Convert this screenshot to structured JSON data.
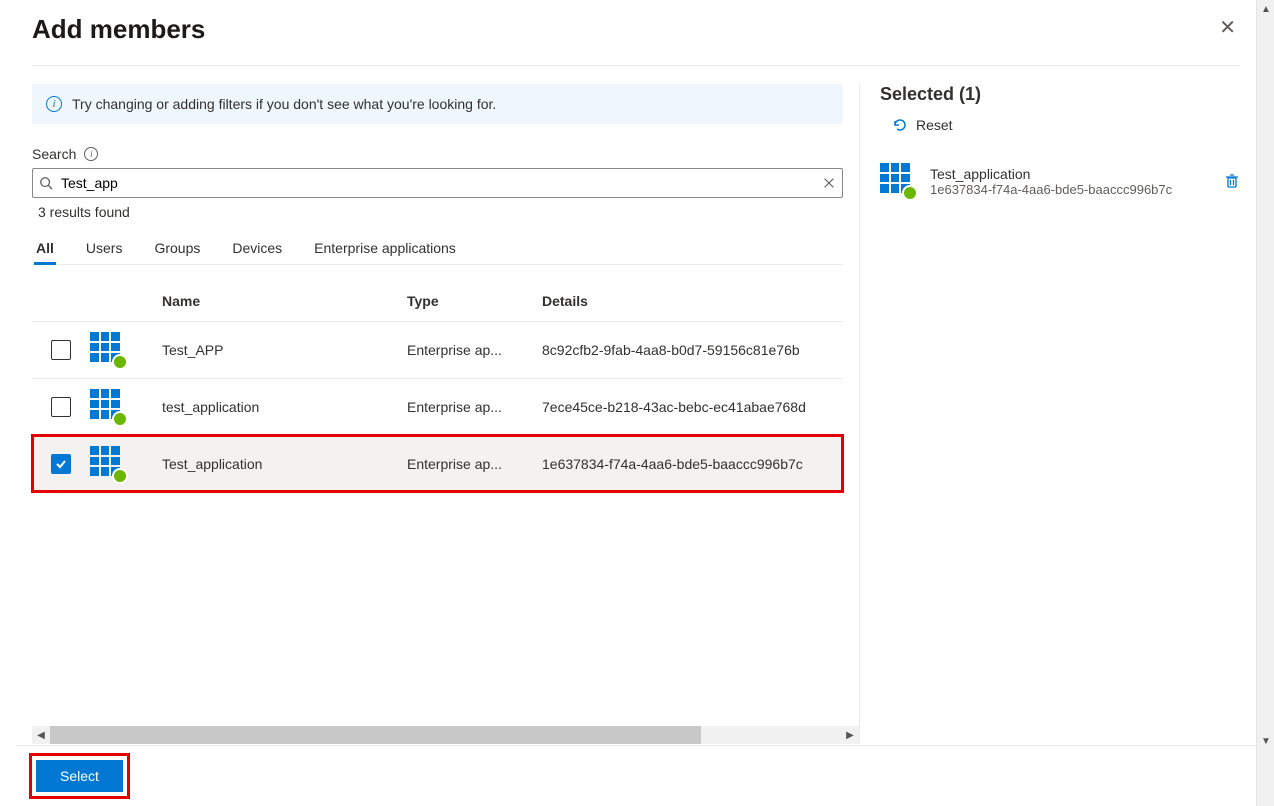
{
  "header": {
    "title": "Add members"
  },
  "banner": {
    "text": "Try changing or adding filters if you don't see what you're looking for."
  },
  "search": {
    "label": "Search",
    "value": "Test_app",
    "results_text": "3 results found"
  },
  "tabs": [
    {
      "label": "All",
      "active": true
    },
    {
      "label": "Users",
      "active": false
    },
    {
      "label": "Groups",
      "active": false
    },
    {
      "label": "Devices",
      "active": false
    },
    {
      "label": "Enterprise applications",
      "active": false
    }
  ],
  "columns": {
    "name": "Name",
    "type": "Type",
    "details": "Details"
  },
  "rows": [
    {
      "checked": false,
      "name": "Test_APP",
      "type": "Enterprise ap...",
      "details": "8c92cfb2-9fab-4aa8-b0d7-59156c81e76b",
      "highlighted": false
    },
    {
      "checked": false,
      "name": "test_application",
      "type": "Enterprise ap...",
      "details": "7ece45ce-b218-43ac-bebc-ec41abae768d",
      "highlighted": false
    },
    {
      "checked": true,
      "name": "Test_application",
      "type": "Enterprise ap...",
      "details": "1e637834-f74a-4aa6-bde5-baaccc996b7c",
      "highlighted": true
    }
  ],
  "selected_panel": {
    "title": "Selected (1)",
    "reset_label": "Reset",
    "items": [
      {
        "name": "Test_application",
        "sub": "1e637834-f74a-4aa6-bde5-baaccc996b7c"
      }
    ]
  },
  "footer": {
    "select_label": "Select"
  }
}
